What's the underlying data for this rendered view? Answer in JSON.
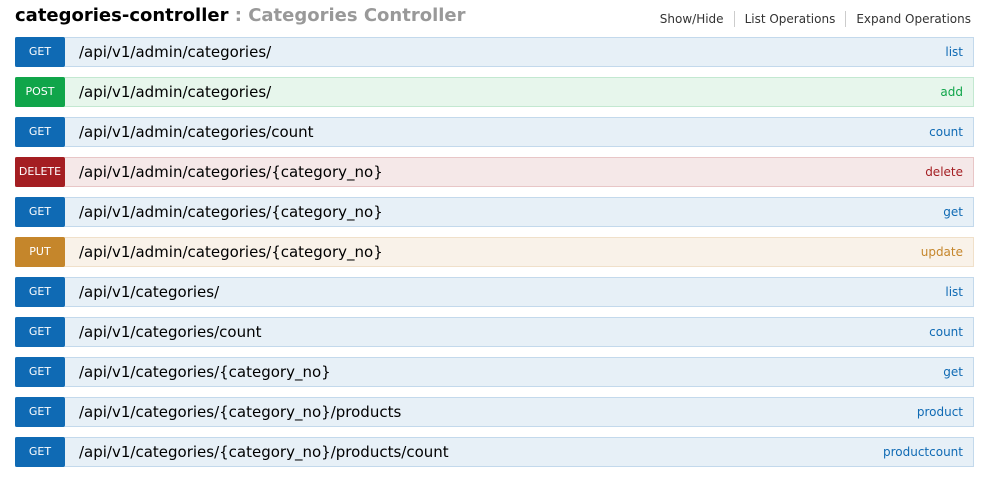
{
  "resource": {
    "name": "categories-controller",
    "separator": " : ",
    "description": "Categories Controller"
  },
  "actions": {
    "show_hide": "Show/Hide",
    "list_operations": "List Operations",
    "expand_operations": "Expand Operations"
  },
  "operations": [
    {
      "method": "GET",
      "path": "/api/v1/admin/categories/",
      "summary": "list"
    },
    {
      "method": "POST",
      "path": "/api/v1/admin/categories/",
      "summary": "add"
    },
    {
      "method": "GET",
      "path": "/api/v1/admin/categories/count",
      "summary": "count"
    },
    {
      "method": "DELETE",
      "path": "/api/v1/admin/categories/{category_no}",
      "summary": "delete"
    },
    {
      "method": "GET",
      "path": "/api/v1/admin/categories/{category_no}",
      "summary": "get"
    },
    {
      "method": "PUT",
      "path": "/api/v1/admin/categories/{category_no}",
      "summary": "update"
    },
    {
      "method": "GET",
      "path": "/api/v1/categories/",
      "summary": "list"
    },
    {
      "method": "GET",
      "path": "/api/v1/categories/count",
      "summary": "count"
    },
    {
      "method": "GET",
      "path": "/api/v1/categories/{category_no}",
      "summary": "get"
    },
    {
      "method": "GET",
      "path": "/api/v1/categories/{category_no}/products",
      "summary": "product"
    },
    {
      "method": "GET",
      "path": "/api/v1/categories/{category_no}/products/count",
      "summary": "productcount"
    }
  ],
  "colors": {
    "get": "#0f6ab4",
    "post": "#10a54a",
    "delete": "#a41e22",
    "put": "#c5862b"
  }
}
